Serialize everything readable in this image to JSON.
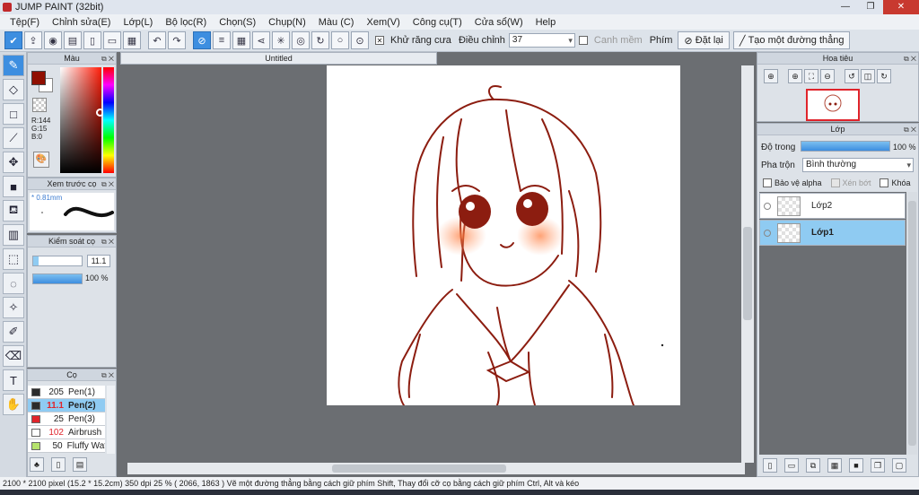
{
  "window": {
    "title": "JUMP PAINT (32bit)"
  },
  "menu": [
    "Tệp(F)",
    "Chỉnh sửa(E)",
    "Lớp(L)",
    "Bộ lọc(R)",
    "Chọn(S)",
    "Chụp(N)",
    "Màu (C)",
    "Xem(V)",
    "Công cụ(T)",
    "Cửa sổ(W)",
    "Help"
  ],
  "toolbar": {
    "antialias_label": "Khử răng cưa",
    "adjust_label": "Điều chỉnh",
    "adjust_value": "37",
    "smooth_label": "Canh mềm",
    "key_label": "Phím",
    "reset_label": "Đặt lại",
    "straight_label": "Tạo một đường thẳng"
  },
  "color_panel": {
    "title": "Màu",
    "r": "R:144",
    "g": "G:15",
    "b": "B:0",
    "main_color": "#900f00"
  },
  "brush_preview": {
    "title": "Xem trước cọ",
    "size": "* 0.81mm"
  },
  "brush_control": {
    "title": "Kiểm soát cọ",
    "size_value": "11.1",
    "opacity_value": "100 %",
    "size_fraction": 0.11,
    "opacity_fraction": 1.0
  },
  "brush_list": {
    "title": "Cọ",
    "items": [
      {
        "size": "205",
        "name": "Pen(1)",
        "color": "#2b2b2b"
      },
      {
        "size": "11.1",
        "name": "Pen(2)",
        "color": "#2b2b2b"
      },
      {
        "size": "25",
        "name": "Pen(3)",
        "color": "#e0242b"
      },
      {
        "size": "102",
        "name": "Airbrush",
        "color": "#ffffff"
      },
      {
        "size": "50",
        "name": "Fluffy Wat",
        "color": "#b6e36c"
      }
    ]
  },
  "document": {
    "tab": "Untitled"
  },
  "navigator": {
    "title": "Hoa tiêu"
  },
  "layers": {
    "title": "Lớp",
    "opacity_label": "Độ trong",
    "opacity_value": "100 %",
    "opacity_fraction": 1.0,
    "blend_label": "Pha trộn",
    "blend_value": "Bình thường",
    "protect_alpha": "Bảo vệ alpha",
    "clip": "Xén bớt",
    "lock": "Khóa",
    "rows": [
      {
        "name": "Lớp2"
      },
      {
        "name": "Lớp1"
      }
    ]
  },
  "status": {
    "text": "2100 * 2100 pixel   (15.2 * 15.2cm)   350 dpi   25 %   ( 2066, 1863 )   Vẽ một đường thẳng bằng cách giữ phím Shift, Thay đổi cỡ cọ bằng cách giữ phím Ctrl, Alt và kéo"
  }
}
